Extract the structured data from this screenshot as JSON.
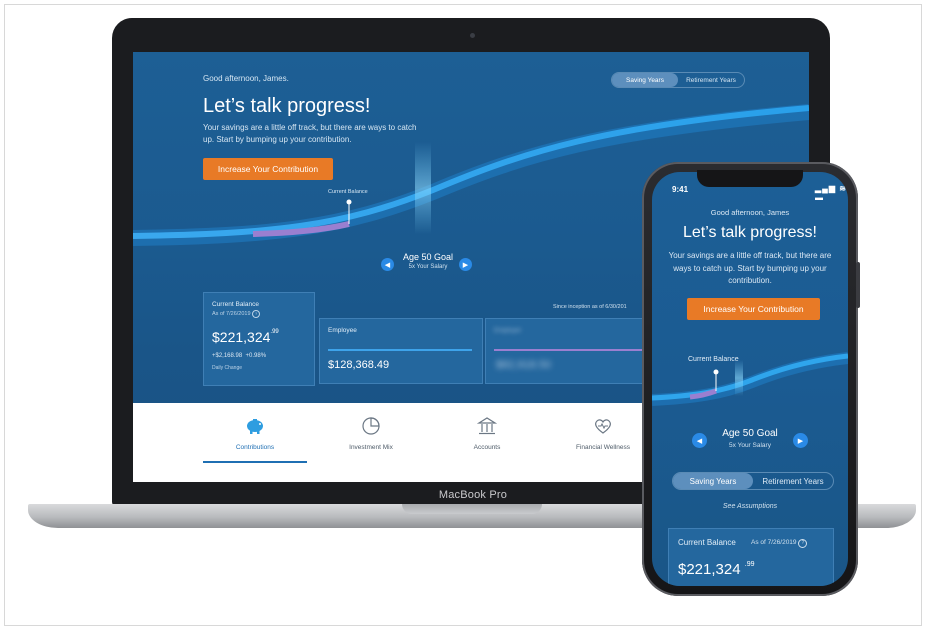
{
  "laptop": {
    "greeting": "Good afternoon, James.",
    "title": "Let’s talk progress!",
    "subtitle": "Your savings are a little off track, but there are ways to catch up. Start by bumping up your contribution.",
    "cta_label": "Increase Your Contribution",
    "toggle": {
      "saving": "Saving Years",
      "retirement": "Retirement Years",
      "active": "saving"
    },
    "current_balance_marker": "Current Balance",
    "goal": {
      "title": "Age 50 Goal",
      "subtitle": "5x Your Salary"
    },
    "since_inception": "Since inception as of 6/30/201",
    "cards": {
      "current_balance": {
        "label": "Current Balance",
        "as_of": "As of 7/26/2019",
        "info_icon": "info-icon",
        "value": "$221,324",
        "cents": ".99",
        "change": "+$2,168.98",
        "change_pct": "+0.98%",
        "change_label": "Daily Change"
      },
      "employee": {
        "label": "Employee",
        "value": "$128,368.49"
      },
      "employer": {
        "label": "Employer",
        "value": "$82,918.50"
      }
    },
    "tabs": [
      {
        "label": "Contributions",
        "icon": "piggy-bank-icon",
        "active": true
      },
      {
        "label": "Investment Mix",
        "icon": "pie-chart-icon",
        "active": false
      },
      {
        "label": "Accounts",
        "icon": "bank-icon",
        "active": false
      },
      {
        "label": "Financial Wellness",
        "icon": "heart-icon",
        "active": false
      }
    ],
    "device_label": "MacBook Pro"
  },
  "phone": {
    "time": "9:41",
    "status": "▂▄▆ ≋ ▬",
    "greeting": "Good afternoon, James",
    "title": "Let’s talk progress!",
    "subtitle": "Your savings are a little off track, but there are ways to catch up. Start by bumping up your contribution.",
    "cta_label": "Increase Your Contribution",
    "current_balance_marker": "Current Balance",
    "goal": {
      "title": "Age 50 Goal",
      "subtitle": "5x Your Salary"
    },
    "toggle": {
      "saving": "Saving Years",
      "retirement": "Retirement Years",
      "active": "saving"
    },
    "assumptions": "See Assumptions",
    "card": {
      "label": "Current Balance",
      "as_of": "As of 7/26/2019",
      "value": "$221,324",
      "cents": ".99"
    }
  },
  "colors": {
    "accent_orange": "#e87a26",
    "screen_blue": "#1d5f95",
    "wave_cyan": "#2a9be8",
    "progress_purple": "#9a7fd0"
  }
}
